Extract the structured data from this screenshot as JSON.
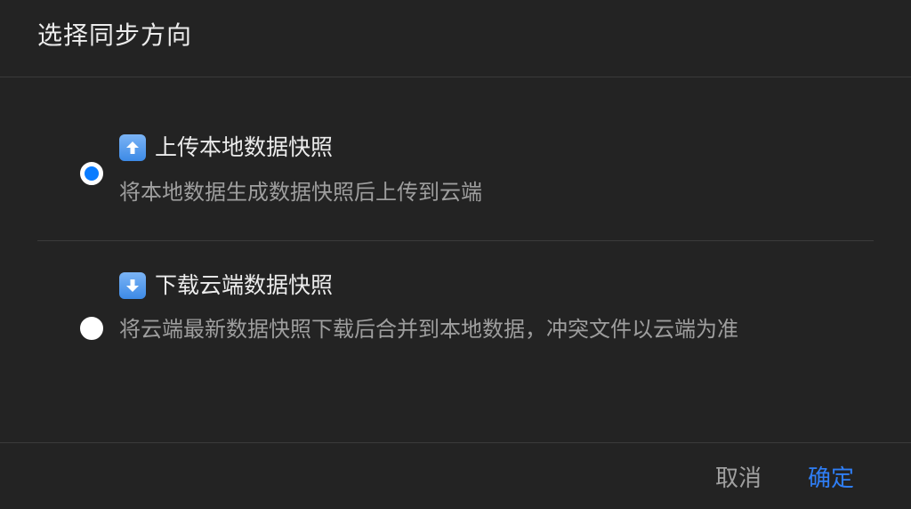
{
  "dialog": {
    "title": "选择同步方向",
    "options": [
      {
        "icon": "up-arrow-icon",
        "label": "上传本地数据快照",
        "description": "将本地数据生成数据快照后上传到云端",
        "selected": true
      },
      {
        "icon": "down-arrow-icon",
        "label": "下载云端数据快照",
        "description": "将云端最新数据快照下载后合并到本地数据，冲突文件以云端为准",
        "selected": false
      }
    ],
    "buttons": {
      "cancel": "取消",
      "confirm": "确定"
    }
  },
  "colors": {
    "background": "#232323",
    "accent": "#2f7ef5",
    "radio_selected": "#0a7cff",
    "secondary_text": "#9e9e9e"
  }
}
